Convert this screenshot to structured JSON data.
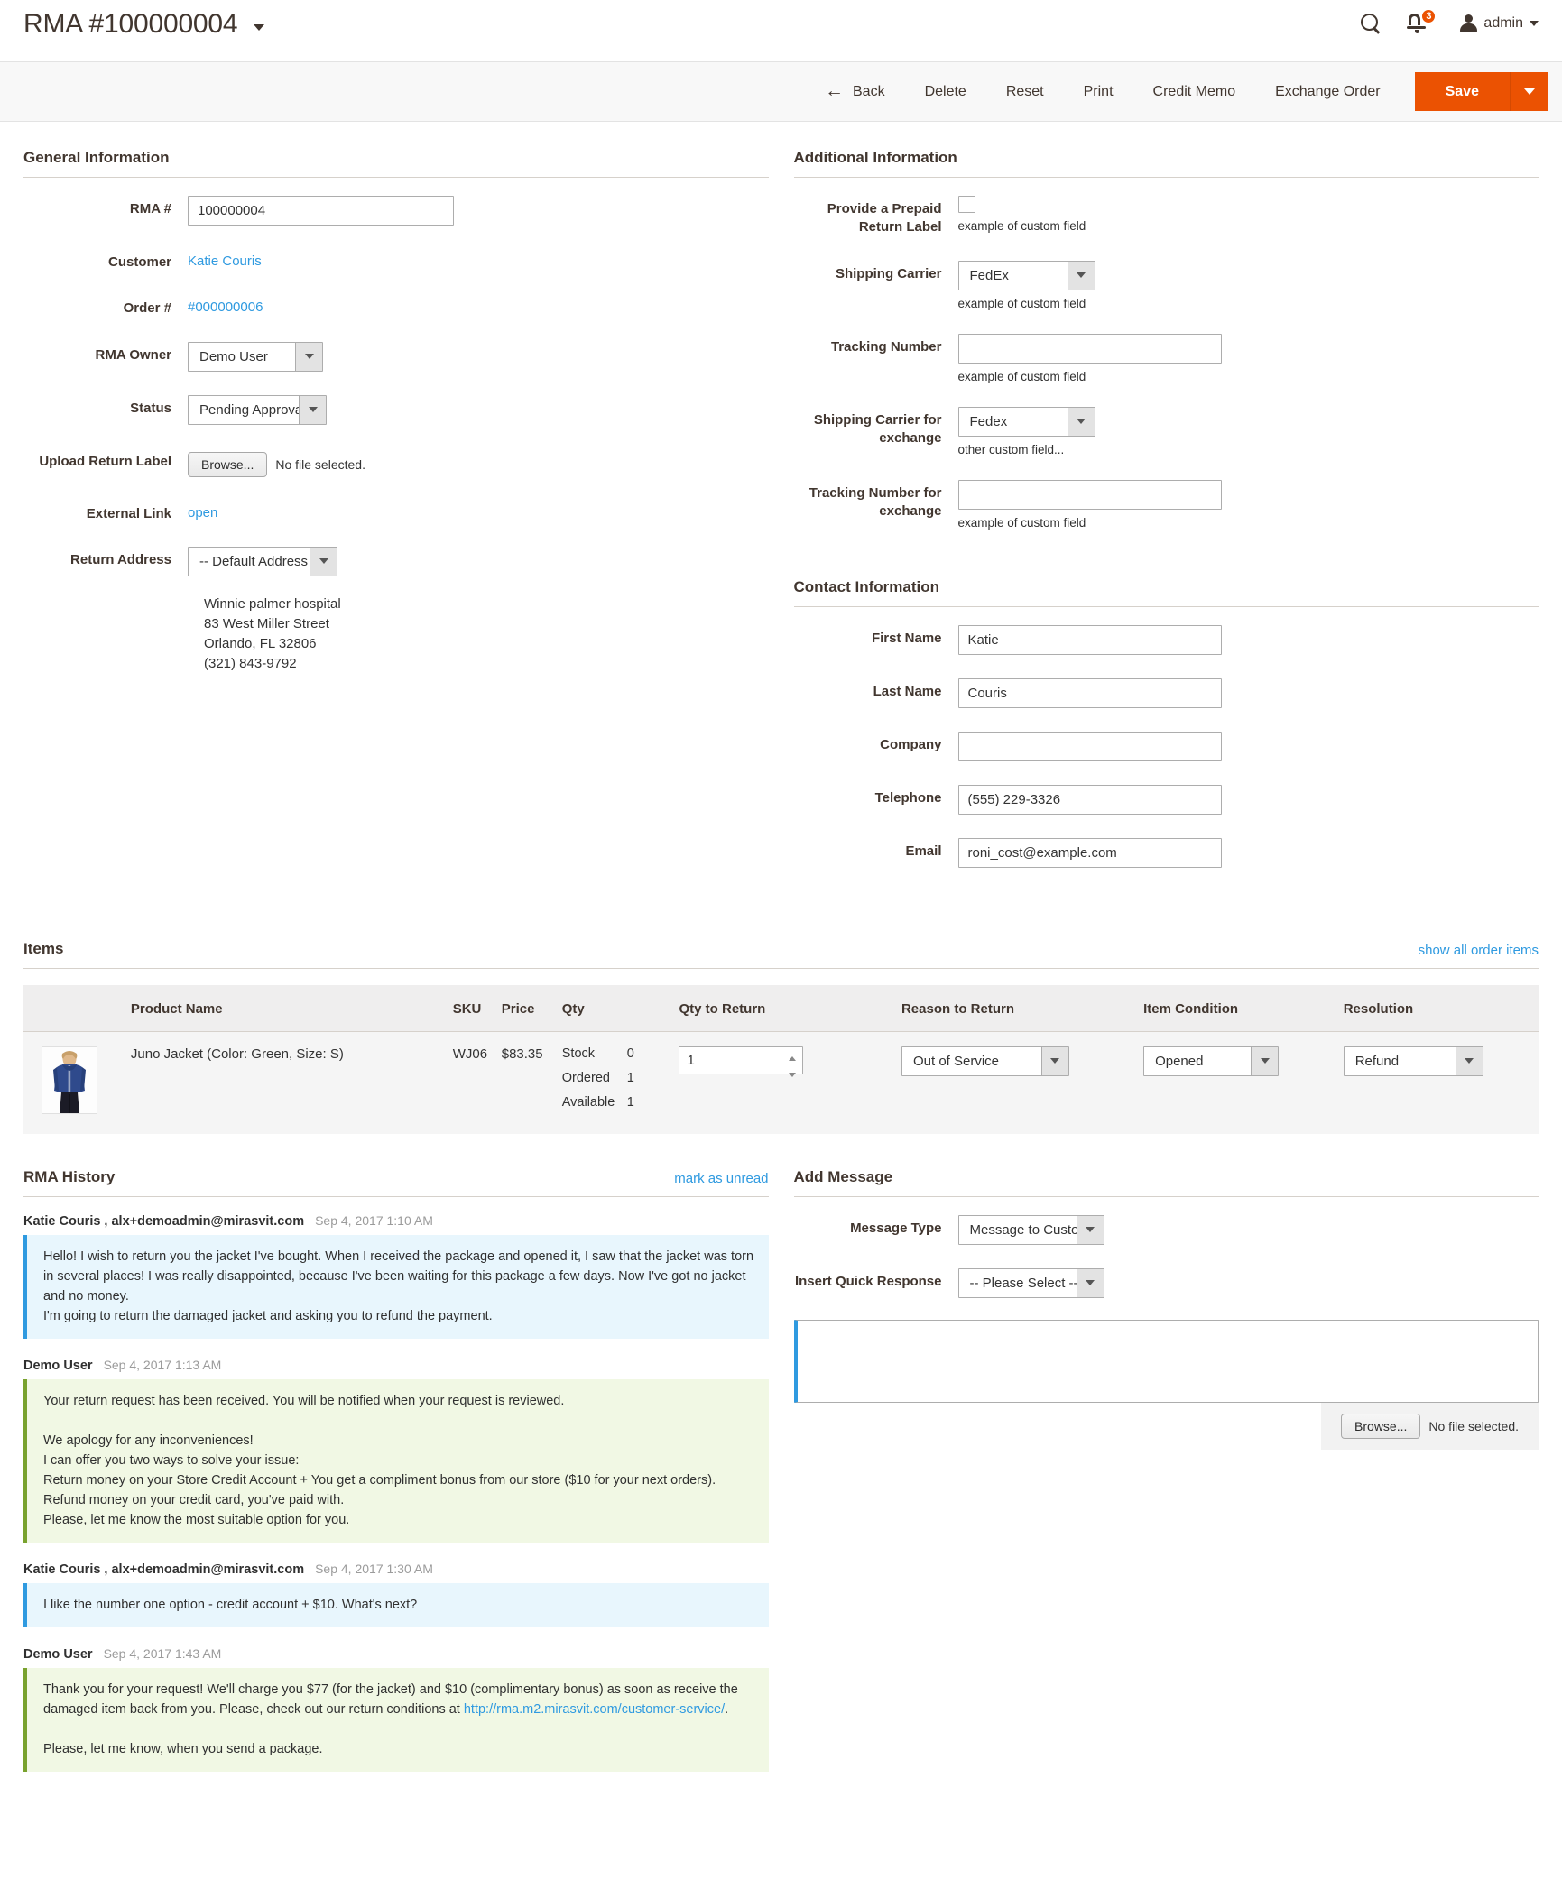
{
  "header": {
    "title": "RMA #100000004",
    "search_icon": "search-icon",
    "notifications": {
      "icon": "bell-icon",
      "count": "3"
    },
    "user": {
      "icon": "user-avatar-icon",
      "label": "admin"
    }
  },
  "toolbar": {
    "back": "Back",
    "back_arrow": "←",
    "delete": "Delete",
    "reset": "Reset",
    "print": "Print",
    "credit_memo": "Credit Memo",
    "exchange_order": "Exchange Order",
    "save": "Save"
  },
  "general": {
    "title": "General Information",
    "labels": {
      "rma": "RMA #",
      "customer": "Customer",
      "order": "Order #",
      "owner": "RMA Owner",
      "status": "Status",
      "upload": "Upload Return Label",
      "external": "External Link",
      "return_address": "Return Address"
    },
    "rma_value": "100000004",
    "customer_link": "Katie Couris",
    "order_link": "#000000006",
    "owner_value": "Demo User",
    "status_value": "Pending Approval",
    "browse_label": "Browse...",
    "no_file": "No file selected.",
    "external_link": "open",
    "return_address_value": "-- Default Address --",
    "address_lines": "Winnie palmer hospital\n83 West Miller Street\nOrlando, FL 32806\n(321) 843-9792"
  },
  "additional": {
    "title": "Additional Information",
    "labels": {
      "prepaid": "Provide a Prepaid Return Label",
      "carrier": "Shipping Carrier",
      "tracking": "Tracking Number",
      "carrier_exchange": "Shipping Carrier for exchange",
      "tracking_exchange": "Tracking Number for exchange"
    },
    "notes": {
      "prepaid": "example of custom field",
      "carrier": "example of custom field",
      "tracking": "example of custom field",
      "carrier_exchange": "other custom field...",
      "tracking_exchange": "example of custom field"
    },
    "carrier_value": "FedEx",
    "tracking_value": "",
    "carrier_exchange_value": "Fedex",
    "tracking_exchange_value": ""
  },
  "contact": {
    "title": "Contact Information",
    "labels": {
      "first_name": "First Name",
      "last_name": "Last Name",
      "company": "Company",
      "telephone": "Telephone",
      "email": "Email"
    },
    "first_name": "Katie",
    "last_name": "Couris",
    "company": "",
    "telephone": "(555) 229-3326",
    "email": "roni_cost@example.com"
  },
  "items": {
    "title": "Items",
    "show_all_link": "show all order items",
    "columns": {
      "image": "",
      "product_name": "Product Name",
      "sku": "SKU",
      "price": "Price",
      "qty": "Qty",
      "qty_to_return": "Qty to Return",
      "reason": "Reason to Return",
      "condition": "Item Condition",
      "resolution": "Resolution"
    },
    "rows": [
      {
        "image_alt": "product-thumbnail-juno-jacket",
        "product_name": "Juno Jacket (Color: Green, Size: S)",
        "sku": "WJ06",
        "price": "$83.35",
        "qty_labels": [
          "Stock",
          "Ordered",
          "Available"
        ],
        "qty_values": [
          "0",
          "1",
          "1"
        ],
        "qty_to_return": "1",
        "reason": "Out of Service",
        "condition": "Opened",
        "resolution": "Refund"
      }
    ]
  },
  "history": {
    "title": "RMA History",
    "mark_unread": "mark as unread",
    "entries": [
      {
        "author": "Katie Couris , alx+demoadmin@mirasvit.com",
        "time": "Sep 4, 2017 1:10 AM",
        "kind": "customer",
        "text": "Hello! I wish to return you the jacket I've bought. When I received the package and opened it, I saw that the jacket was torn in several places! I was really disappointed, because I've been waiting for this package a few days. Now I've got no jacket and no money.\nI'm going to return the damaged jacket and asking you to refund the payment."
      },
      {
        "author": "Demo User",
        "time": "Sep 4, 2017 1:13 AM",
        "kind": "admin",
        "text": "Your return request has been received. You will be notified when your request is reviewed.\n\nWe apology for any inconveniences!\nI can offer you two ways to solve your issue:\nReturn money on your Store Credit Account + You get a compliment bonus from our store ($10 for your next orders).\nRefund money on your credit card, you've paid with.\nPlease, let me know the most suitable option for you."
      },
      {
        "author": "Katie Couris , alx+demoadmin@mirasvit.com",
        "time": "Sep 4, 2017 1:30 AM",
        "kind": "customer",
        "text": "I like the number one option - credit account + $10. What's next?"
      },
      {
        "author": "Demo User",
        "time": "Sep 4, 2017 1:43 AM",
        "kind": "admin",
        "text_before_link": "Thank you for your request! We'll charge you $77 (for the jacket) and $10 (complimentary bonus) as soon as receive the damaged item back from you. Please, check out our return conditions at ",
        "link_text": "http://rma.m2.mirasvit.com/customer-service/",
        "text_after_link": ".\n\nPlease, let me know, when you send a package."
      }
    ]
  },
  "add_message": {
    "title": "Add Message",
    "labels": {
      "message_type": "Message Type",
      "quick_response": "Insert Quick Response"
    },
    "message_type_value": "Message to Customer",
    "quick_response_value": "-- Please Select --",
    "message_text": "",
    "browse_label": "Browse...",
    "no_file": "No file selected."
  },
  "colors": {
    "accent": "#eb5202",
    "link": "#2f9ae0",
    "customer_bubble": "#e8f6fd",
    "admin_bubble": "#f1f8e4",
    "admin_bar": "#79a22e"
  }
}
